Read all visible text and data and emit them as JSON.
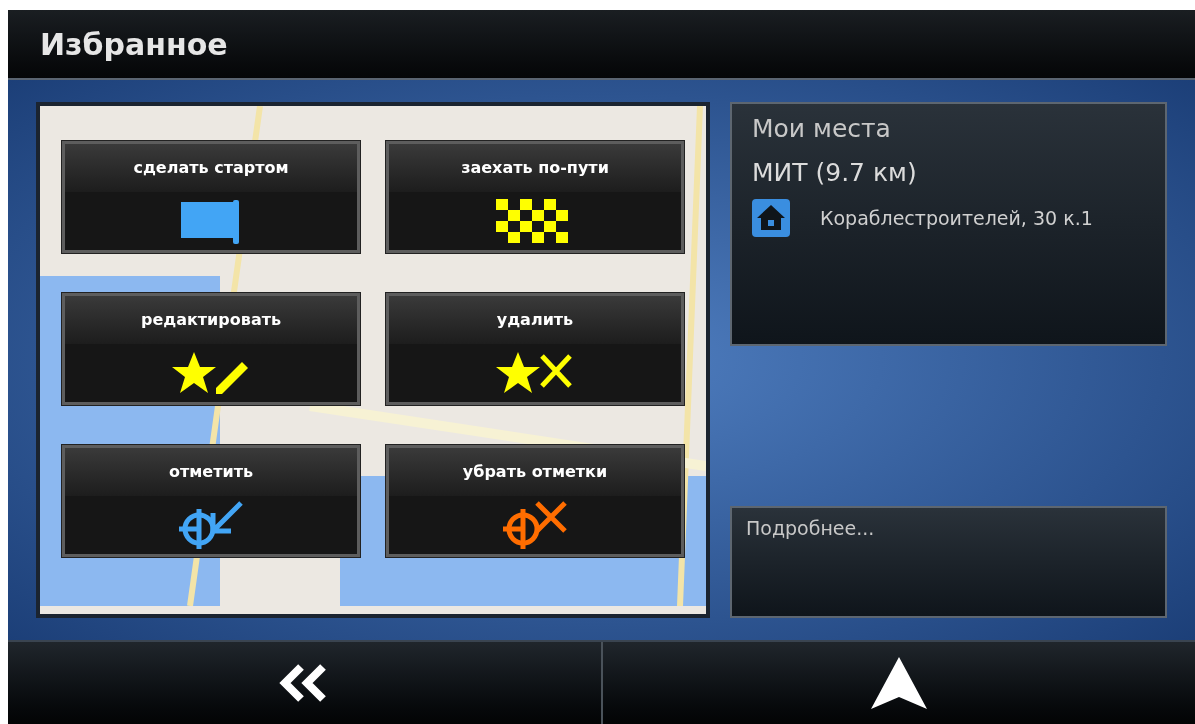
{
  "header": {
    "title": "Избранное"
  },
  "actions": [
    {
      "label": "сделать стартом",
      "kind": "start"
    },
    {
      "label": "заехать по-пути",
      "kind": "waypoint"
    },
    {
      "label": "редактировать",
      "kind": "edit"
    },
    {
      "label": "удалить",
      "kind": "delete"
    },
    {
      "label": "отметить",
      "kind": "mark"
    },
    {
      "label": "убрать отметки",
      "kind": "unmark"
    }
  ],
  "place_panel": {
    "heading": "Мои места",
    "name": "МИТ (9.7 км)",
    "address": "Кораблестроителей, 30 к.1"
  },
  "details_panel": {
    "label": "Подробнее..."
  },
  "bottom_bar": [
    {
      "kind": "back"
    },
    {
      "kind": "navigate"
    }
  ]
}
